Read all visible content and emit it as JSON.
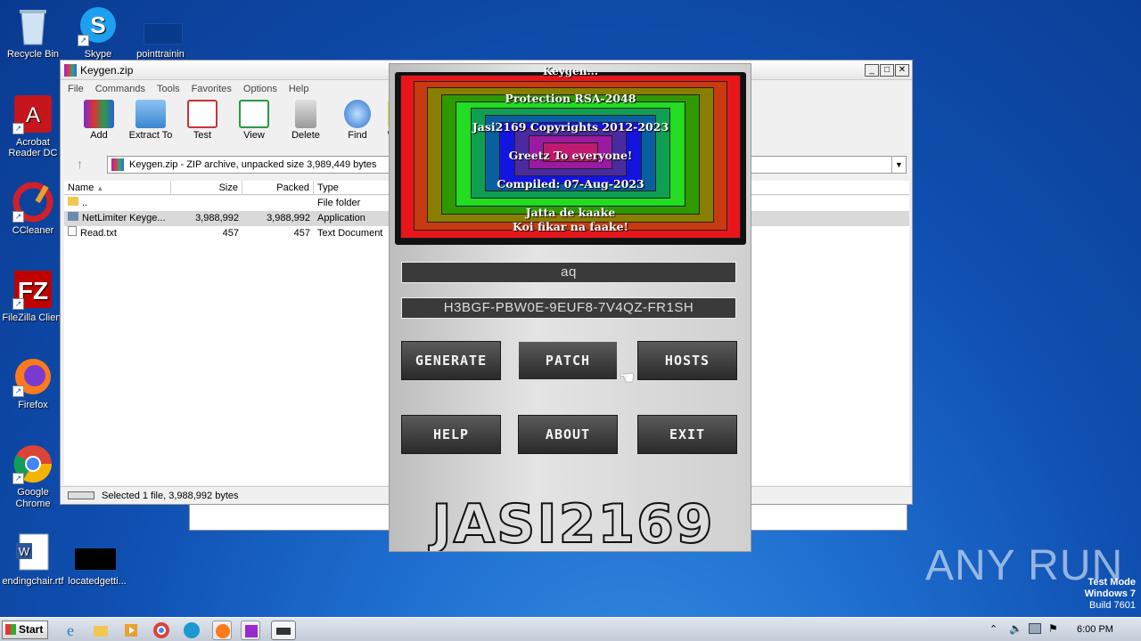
{
  "desktop": {
    "icons": [
      {
        "label": "Recycle Bin"
      },
      {
        "label": "Skype"
      },
      {
        "label": "pointtrainin"
      },
      {
        "label": "Acrobat Reader DC"
      },
      {
        "label": "CCleaner"
      },
      {
        "label": "FileZilla Client"
      },
      {
        "label": "Firefox"
      },
      {
        "label": "Google Chrome"
      },
      {
        "label": "endingchair.rtf"
      },
      {
        "label": "locatedgetti..."
      }
    ]
  },
  "winrar": {
    "title": "Keygen.zip",
    "menu": [
      "File",
      "Commands",
      "Tools",
      "Favorites",
      "Options",
      "Help"
    ],
    "toolbar": [
      "Add",
      "Extract To",
      "Test",
      "View",
      "Delete",
      "Find",
      "W"
    ],
    "address": "Keygen.zip - ZIP archive, unpacked size 3,989,449 bytes",
    "columns": [
      "Name",
      "Size",
      "Packed",
      "Type"
    ],
    "rows": [
      {
        "name": "..",
        "size": "",
        "packed": "",
        "type": "File folder"
      },
      {
        "name": "NetLimiter Keyge...",
        "size": "3,988,992",
        "packed": "3,988,992",
        "type": "Application"
      },
      {
        "name": "Read.txt",
        "size": "457",
        "packed": "457",
        "type": "Text Document"
      }
    ],
    "status": "Selected 1 file, 3,988,992 bytes"
  },
  "keygen": {
    "lines": {
      "top": "Keygen...",
      "l1": "Protection RSA-2048",
      "l2": "Jasi2169 Copyrights 2012-2023",
      "l3": "Greetz To everyone!",
      "l4": "Compiled: 07-Aug-2023",
      "l5": "Jatta de kaake",
      "l6": "Koi fikar na faake!"
    },
    "name_value": "aq",
    "serial_value": "H3BGF-PBW0E-9EUF8-7V4QZ-FR1SH",
    "buttons": {
      "generate": "GENERATE",
      "patch": "PATCH",
      "hosts": "HOSTS",
      "help": "HELP",
      "about": "ABOUT",
      "exit": "EXIT"
    },
    "logo": "JASI2169"
  },
  "taskbar": {
    "start": "Start",
    "clock": "6:00 PM"
  },
  "watermark": "ANY RUN",
  "testmode": {
    "l1": "Test Mode",
    "l2": "Windows 7",
    "l3": "Build 7601"
  }
}
